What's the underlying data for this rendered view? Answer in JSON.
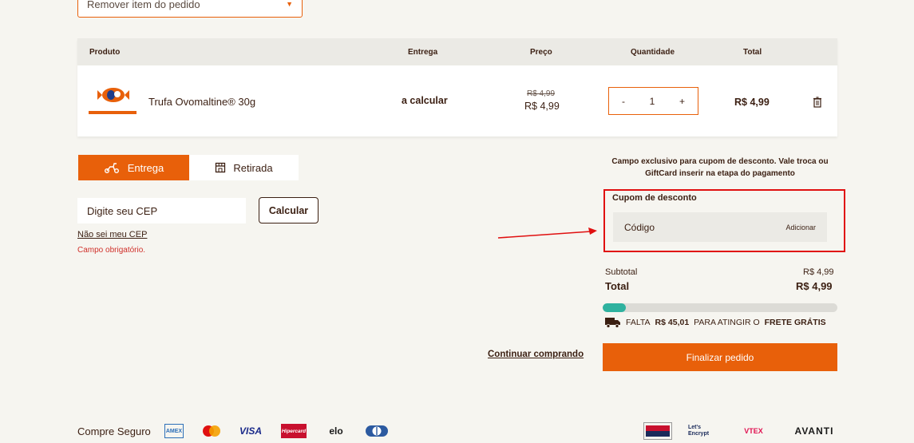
{
  "top_select": {
    "label": "Remover item do pedido"
  },
  "table": {
    "headers": {
      "product": "Produto",
      "delivery": "Entrega",
      "price": "Preço",
      "quantity": "Quantidade",
      "total": "Total"
    },
    "row": {
      "product_name": "Trufa Ovomaltine® 30g",
      "delivery": "a calcular",
      "old_price": "R$ 4,99",
      "price": "R$ 4,99",
      "qty_minus": "-",
      "quantity": "1",
      "qty_plus": "+",
      "total": "R$ 4,99"
    }
  },
  "shipping": {
    "tab_delivery": "Entrega",
    "tab_pickup": "Retirada",
    "cep_placeholder": "Digite seu CEP",
    "calc_button": "Calcular",
    "dont_know_cep": "Não sei meu CEP",
    "required_msg": "Campo obrigatório."
  },
  "coupon": {
    "note": "Campo exclusivo para cupom de desconto. Vale troca ou GiftCard inserir na etapa do pagamento",
    "title": "Cupom de desconto",
    "field_label": "Código",
    "add_button": "Adicionar"
  },
  "summary": {
    "subtotal_label": "Subtotal",
    "subtotal_value": "R$ 4,99",
    "total_label": "Total",
    "total_value": "R$ 4,99",
    "progress_fraction": 0.1,
    "frete_prefix": "FALTA",
    "frete_amount": "R$ 45,01",
    "frete_middle": "PARA ATINGIR O",
    "frete_goal": "FRETE GRÁTIS"
  },
  "actions": {
    "continue": "Continuar comprando",
    "checkout": "Finalizar pedido"
  },
  "footer": {
    "secure_label": "Compre Seguro",
    "payments": [
      "AMEX",
      "Mastercard",
      "VISA",
      "Hipercard",
      "elo",
      "Diners"
    ],
    "partners": [
      "Site Blindado",
      "Let's Encrypt",
      "VTEX",
      "AVANTI"
    ]
  },
  "colors": {
    "accent": "#e8600a",
    "text": "#3b1f12",
    "progress": "#2fb29f",
    "highlight": "#e01010"
  }
}
